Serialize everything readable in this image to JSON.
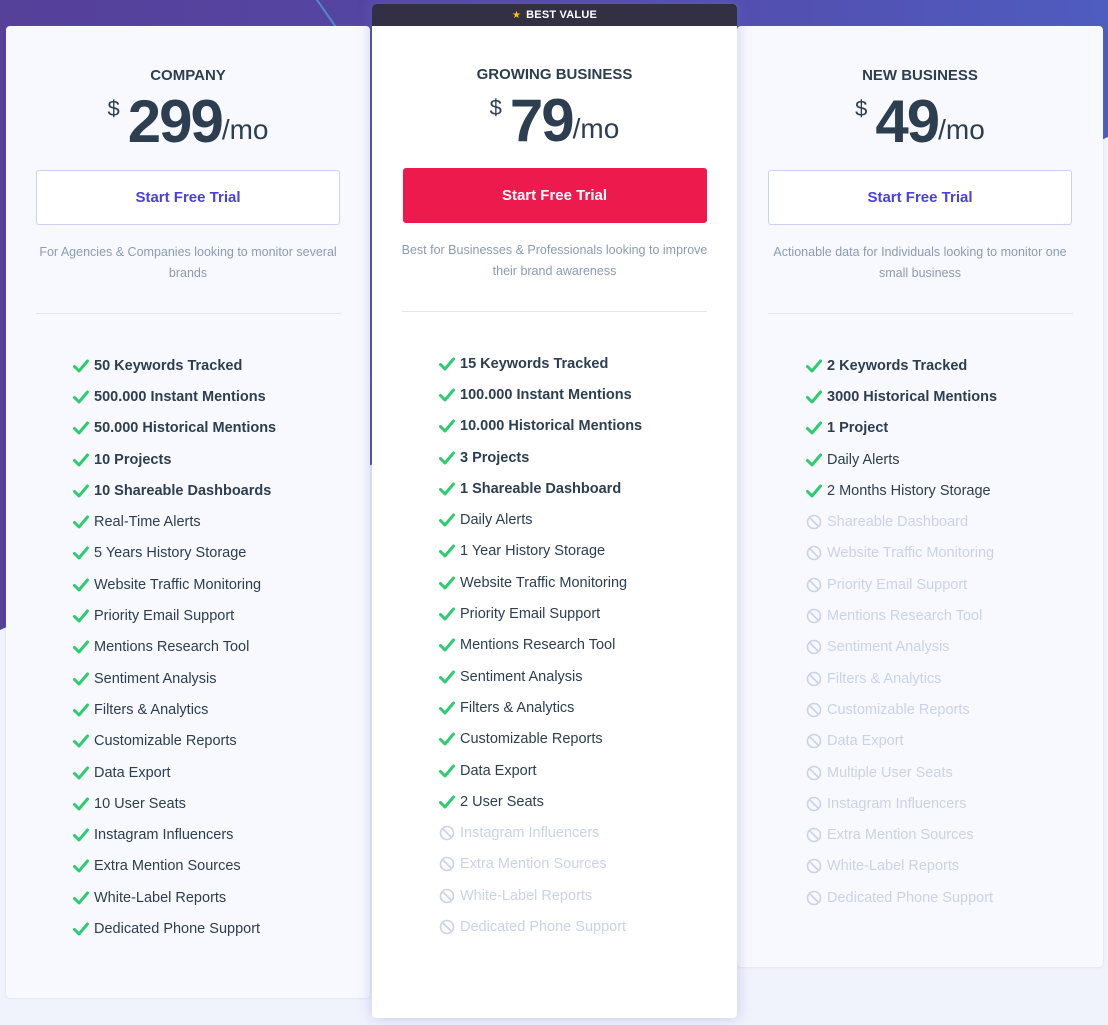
{
  "badge": {
    "label": "BEST VALUE",
    "icon": "star-icon"
  },
  "plans": [
    {
      "name": "COMPANY",
      "currency": "$",
      "amount": "299",
      "period": "/mo",
      "cta": "Start Free Trial",
      "description": "For Agencies & Companies looking to monitor several brands",
      "features": [
        {
          "label": "50 Keywords Tracked",
          "included": true,
          "bold": true
        },
        {
          "label": "500.000 Instant Mentions",
          "included": true,
          "bold": true
        },
        {
          "label": "50.000 Historical Mentions",
          "included": true,
          "bold": true
        },
        {
          "label": "10 Projects",
          "included": true,
          "bold": true
        },
        {
          "label": "10 Shareable Dashboards",
          "included": true,
          "bold": true
        },
        {
          "label": "Real-Time Alerts",
          "included": true,
          "bold": false
        },
        {
          "label": "5 Years History Storage",
          "included": true,
          "bold": false
        },
        {
          "label": "Website Traffic Monitoring",
          "included": true,
          "bold": false
        },
        {
          "label": "Priority Email Support",
          "included": true,
          "bold": false
        },
        {
          "label": "Mentions Research Tool",
          "included": true,
          "bold": false
        },
        {
          "label": "Sentiment Analysis",
          "included": true,
          "bold": false
        },
        {
          "label": "Filters & Analytics",
          "included": true,
          "bold": false
        },
        {
          "label": "Customizable Reports",
          "included": true,
          "bold": false
        },
        {
          "label": "Data Export",
          "included": true,
          "bold": false
        },
        {
          "label": "10 User Seats",
          "included": true,
          "bold": false
        },
        {
          "label": "Instagram Influencers",
          "included": true,
          "bold": false
        },
        {
          "label": "Extra Mention Sources",
          "included": true,
          "bold": false
        },
        {
          "label": "White-Label Reports",
          "included": true,
          "bold": false
        },
        {
          "label": "Dedicated Phone Support",
          "included": true,
          "bold": false
        }
      ]
    },
    {
      "name": "GROWING BUSINESS",
      "currency": "$",
      "amount": "79",
      "period": "/mo",
      "cta": "Start Free Trial",
      "description": "Best for Businesses & Professionals looking to improve their brand awareness",
      "features": [
        {
          "label": "15 Keywords Tracked",
          "included": true,
          "bold": true
        },
        {
          "label": "100.000 Instant Mentions",
          "included": true,
          "bold": true
        },
        {
          "label": "10.000 Historical Mentions",
          "included": true,
          "bold": true
        },
        {
          "label": "3 Projects",
          "included": true,
          "bold": true
        },
        {
          "label": "1 Shareable Dashboard",
          "included": true,
          "bold": true
        },
        {
          "label": "Daily Alerts",
          "included": true,
          "bold": false
        },
        {
          "label": "1 Year History Storage",
          "included": true,
          "bold": false
        },
        {
          "label": "Website Traffic Monitoring",
          "included": true,
          "bold": false
        },
        {
          "label": "Priority Email Support",
          "included": true,
          "bold": false
        },
        {
          "label": "Mentions Research Tool",
          "included": true,
          "bold": false
        },
        {
          "label": "Sentiment Analysis",
          "included": true,
          "bold": false
        },
        {
          "label": "Filters & Analytics",
          "included": true,
          "bold": false
        },
        {
          "label": "Customizable Reports",
          "included": true,
          "bold": false
        },
        {
          "label": "Data Export",
          "included": true,
          "bold": false
        },
        {
          "label": "2 User Seats",
          "included": true,
          "bold": false
        },
        {
          "label": "Instagram Influencers",
          "included": false,
          "bold": false
        },
        {
          "label": "Extra Mention Sources",
          "included": false,
          "bold": false
        },
        {
          "label": "White-Label Reports",
          "included": false,
          "bold": false
        },
        {
          "label": "Dedicated Phone Support",
          "included": false,
          "bold": false
        }
      ]
    },
    {
      "name": "NEW BUSINESS",
      "currency": "$",
      "amount": "49",
      "period": "/mo",
      "cta": "Start Free Trial",
      "description": "Actionable data for Individuals looking to monitor one small business",
      "features": [
        {
          "label": "2 Keywords Tracked",
          "included": true,
          "bold": true
        },
        {
          "label": "3000 Historical Mentions",
          "included": true,
          "bold": true
        },
        {
          "label": "1 Project",
          "included": true,
          "bold": true
        },
        {
          "label": "Daily Alerts",
          "included": true,
          "bold": false
        },
        {
          "label": "2 Months History Storage",
          "included": true,
          "bold": false
        },
        {
          "label": "Shareable Dashboard",
          "included": false,
          "bold": false
        },
        {
          "label": "Website Traffic Monitoring",
          "included": false,
          "bold": false
        },
        {
          "label": "Priority Email Support",
          "included": false,
          "bold": false
        },
        {
          "label": "Mentions Research Tool",
          "included": false,
          "bold": false
        },
        {
          "label": "Sentiment Analysis",
          "included": false,
          "bold": false
        },
        {
          "label": "Filters & Analytics",
          "included": false,
          "bold": false
        },
        {
          "label": "Customizable Reports",
          "included": false,
          "bold": false
        },
        {
          "label": "Data Export",
          "included": false,
          "bold": false
        },
        {
          "label": "Multiple User Seats",
          "included": false,
          "bold": false
        },
        {
          "label": "Instagram Influencers",
          "included": false,
          "bold": false
        },
        {
          "label": "Extra Mention Sources",
          "included": false,
          "bold": false
        },
        {
          "label": "White-Label Reports",
          "included": false,
          "bold": false
        },
        {
          "label": "Dedicated Phone Support",
          "included": false,
          "bold": false
        }
      ]
    }
  ],
  "colors": {
    "accent_purple": "#4a3fe0",
    "cta_red": "#ec1a4d",
    "check_green": "#2ecc71",
    "badge_bg": "#343044",
    "star_yellow": "#f5c518"
  }
}
